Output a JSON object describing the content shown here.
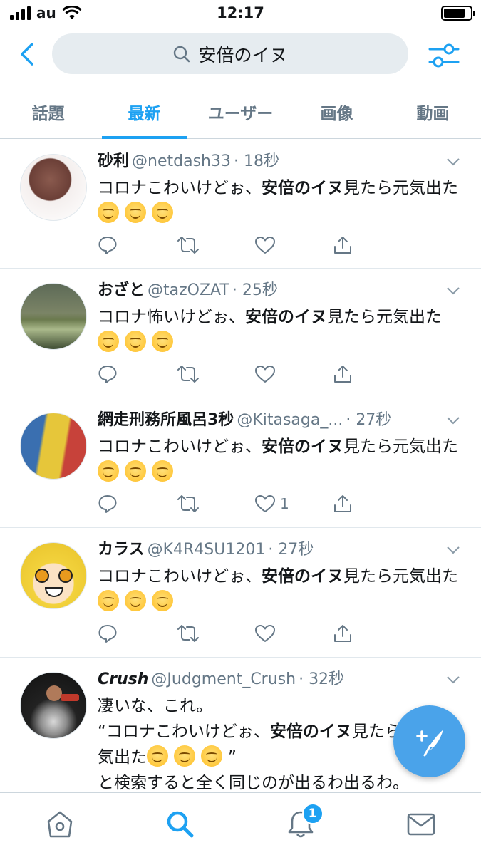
{
  "status_bar": {
    "carrier": "au",
    "time": "12:17"
  },
  "search": {
    "query": "安倍のイヌ"
  },
  "tabs": [
    {
      "label": "話題",
      "active": false
    },
    {
      "label": "最新",
      "active": true
    },
    {
      "label": "ユーザー",
      "active": false
    },
    {
      "label": "画像",
      "active": false
    },
    {
      "label": "動画",
      "active": false
    }
  ],
  "tweets": [
    {
      "name": "砂利",
      "handle": "@netdash33",
      "time": "· 18秒",
      "text_before": "コロナこわいけどぉ、",
      "text_bold": "安倍のイヌ",
      "text_after": "見たら元気出た",
      "like_count": ""
    },
    {
      "name": "おざと",
      "handle": "@tazOZAT",
      "time": "· 25秒",
      "text_before": "コロナ怖いけどぉ、",
      "text_bold": "安倍のイヌ",
      "text_after": "見たら元気出た",
      "like_count": ""
    },
    {
      "name": "網走刑務所風呂3秒",
      "handle": "@Kitasaga_...",
      "time": "· 27秒",
      "text_before": "コロナこわいけどぉ、",
      "text_bold": "安倍のイヌ",
      "text_after": "見たら元気出た",
      "like_count": "1"
    },
    {
      "name": "カラス",
      "handle": "@K4R4SU1201",
      "time": "· 27秒",
      "text_before": "コロナこわいけどぉ、",
      "text_bold": "安倍のイヌ",
      "text_after": "見たら元気出た",
      "like_count": ""
    },
    {
      "name": "Crush",
      "handle": "@Judgment_Crush",
      "time": "· 32秒",
      "line1": "凄いな、これ。",
      "quote_before": "“コロナこわいけどぉ、",
      "quote_bold": "安倍のイヌ",
      "quote_after": "見たら元",
      "line3_start": "気出た",
      "line3_end": "”",
      "line4": "と検索すると全く同じのが出るわ出るわ。"
    }
  ],
  "notifications": {
    "badge": "1"
  },
  "colors": {
    "accent": "#1da1f2",
    "secondary_text": "#657786",
    "search_bg": "#e6ecf0"
  }
}
